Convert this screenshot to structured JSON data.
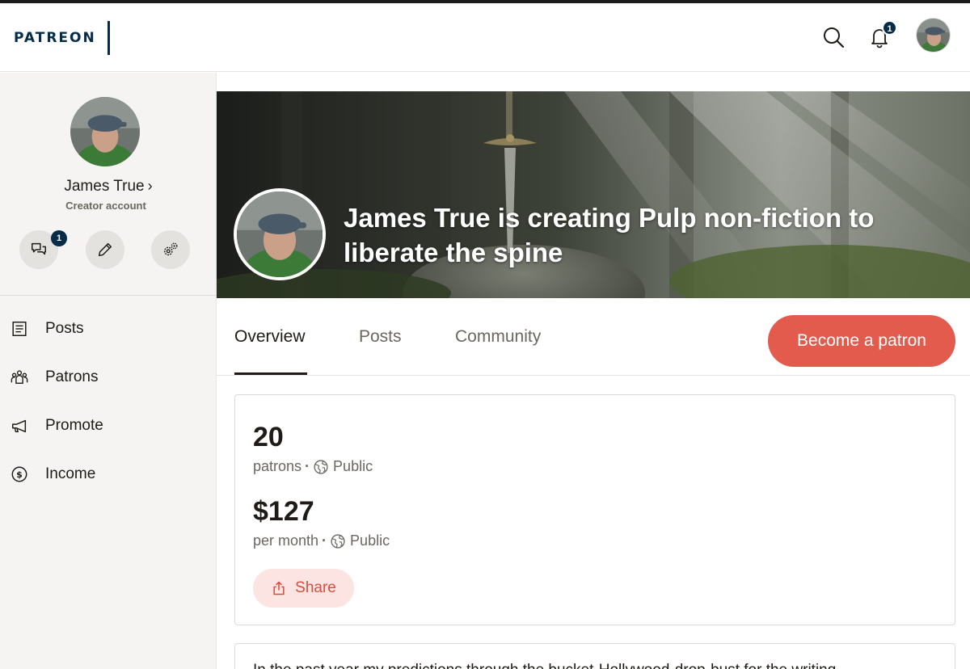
{
  "header": {
    "logo": "PATREON",
    "notification_count": "1"
  },
  "sidebar": {
    "name": "James True",
    "name_chevron": "›",
    "subtitle": "Creator account",
    "messages_badge": "1",
    "nav": [
      {
        "label": "Posts",
        "icon": "document-list-icon"
      },
      {
        "label": "Patrons",
        "icon": "people-icon"
      },
      {
        "label": "Promote",
        "icon": "megaphone-icon"
      },
      {
        "label": "Income",
        "icon": "dollar-circle-icon"
      }
    ]
  },
  "banner": {
    "title": "James True is creating Pulp non-fiction to liberate the spine"
  },
  "tabs": [
    {
      "label": "Overview",
      "active": true
    },
    {
      "label": "Posts",
      "active": false
    },
    {
      "label": "Community",
      "active": false
    }
  ],
  "become_patron": "Become a patron",
  "stats": {
    "patrons_count": "20",
    "patrons_label": "patrons",
    "patrons_visibility": "Public",
    "income_amount": "$127",
    "income_label": "per month",
    "income_visibility": "Public",
    "share_label": "Share"
  },
  "about_preview": "In the past year my predictions through the bucket-Hollywood-drop-bust for the writing",
  "colors": {
    "brand_navy": "#052d49",
    "accent_coral": "#e35b4c",
    "share_bg": "#fbe4e1"
  }
}
